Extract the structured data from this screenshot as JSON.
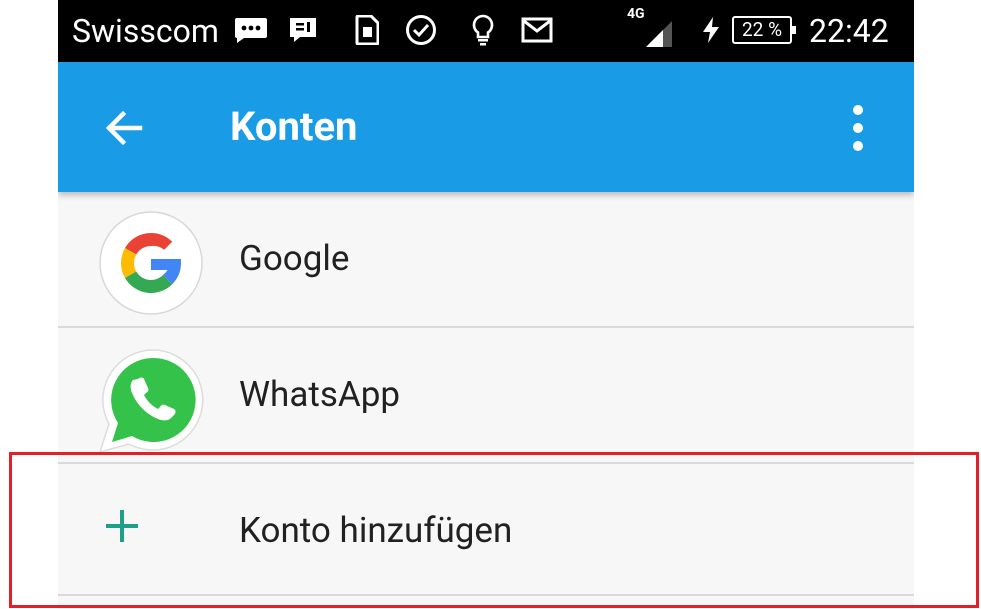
{
  "status_bar": {
    "carrier": "Swisscom",
    "network": "4G",
    "battery": "22 %",
    "time": "22:42",
    "icons": [
      "chat-bubble-icon",
      "message-icon",
      "sim-icon",
      "check-circle-icon",
      "lightbulb-icon",
      "gmail-icon",
      "signal-icon",
      "charging-icon"
    ]
  },
  "app_bar": {
    "title": "Konten",
    "background": "#1a9be6"
  },
  "accounts": [
    {
      "label": "Google",
      "icon": "google-icon"
    },
    {
      "label": "WhatsApp",
      "icon": "whatsapp-icon"
    }
  ],
  "add_account": {
    "label": "Konto hinzufügen",
    "icon": "plus-icon",
    "icon_color": "#1e9f8a"
  },
  "highlight_color": "#e3202a"
}
